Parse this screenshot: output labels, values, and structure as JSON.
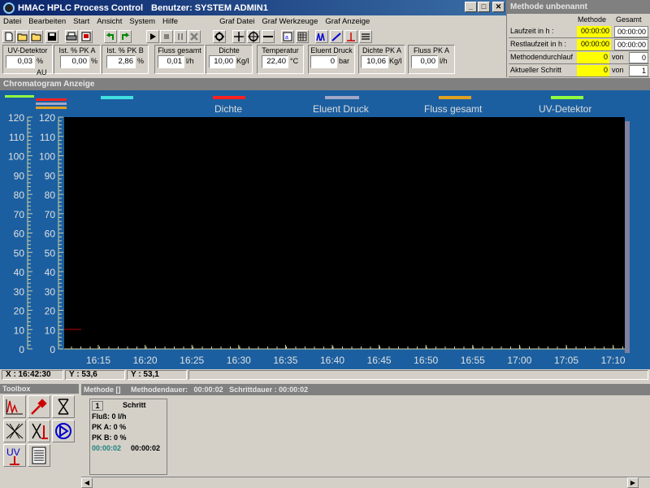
{
  "app": {
    "title": "HMAC HPLC Process Control",
    "user": "Benutzer: SYSTEM ADMIN1"
  },
  "menu": [
    "Datei",
    "Bearbeiten",
    "Start",
    "Ansicht",
    "System",
    "Hilfe",
    "Graf Datei",
    "Graf Werkzeuge",
    "Graf Anzeige"
  ],
  "fields": [
    {
      "label": "UV-Detektor",
      "value": "0,03",
      "unit": "% AU"
    },
    {
      "label": "Ist. % PK A",
      "value": "0,00",
      "unit": "%"
    },
    {
      "label": "Ist. % PK B",
      "value": "2,86",
      "unit": "%"
    },
    {
      "label": "Fluss gesamt",
      "value": "0,01",
      "unit": "l/h"
    },
    {
      "label": "Dichte",
      "value": "10,00",
      "unit": "Kg/l"
    },
    {
      "label": "Temperatur",
      "value": "22,40",
      "unit": "°C"
    },
    {
      "label": "Eluent Druck",
      "value": "0",
      "unit": "bar"
    },
    {
      "label": "Dichte PK A",
      "value": "10,06",
      "unit": "Kg/l"
    },
    {
      "label": "Fluss PK A",
      "value": "0,00",
      "unit": "l/h"
    }
  ],
  "method_panel": {
    "title": "Methode unbenannt",
    "col1": "Methode",
    "col2": "Gesamt",
    "laufzeit_label": "Laufzeit in h :",
    "laufzeit_methode": "00:00:00",
    "laufzeit_gesamt": "00:00:00",
    "restlaufzeit_label": "Restlaufzeit in h :",
    "restlaufzeit_methode": "00:00:00",
    "restlaufzeit_gesamt": "00:00:00",
    "durchlauf_label": "Methodendurchlauf",
    "durchlauf_value": "0",
    "durchlauf_von": "von",
    "durchlauf_total": "0",
    "schritt_label": "Aktueller Schritt",
    "schritt_value": "0",
    "schritt_von": "von",
    "schritt_total": "1"
  },
  "chromatogram": {
    "title": "Chromatogram Anzeige",
    "legend": [
      {
        "label": "Dichte",
        "color": "#ff2020"
      },
      {
        "label": "Eluent Druck",
        "color": "#a0a8c8"
      },
      {
        "label": "Fluss gesamt",
        "color": "#e0a020"
      },
      {
        "label": "UV-Detektor",
        "color": "#90ff40"
      }
    ],
    "y_ticks": [
      "120",
      "110",
      "100",
      "90",
      "80",
      "70",
      "60",
      "50",
      "40",
      "30",
      "20",
      "10",
      "0"
    ],
    "x_ticks": [
      "16:15",
      "16:20",
      "16:25",
      "16:30",
      "16:35",
      "16:40",
      "16:45",
      "16:50",
      "16:55",
      "17:00",
      "17:05",
      "17:10"
    ]
  },
  "status": {
    "x": "X : 16:42:30",
    "y1": "Y : 53,6",
    "y2": "Y : 53,1"
  },
  "toolbox": {
    "title": "Toolbox"
  },
  "method_bottom": {
    "title": "Methode []",
    "dauer_label": "Methodendauer:",
    "dauer_value": "00:00:02",
    "schritt_label": "Schrittdauer : 00:00:02",
    "step_num": "1",
    "step_header": "Schritt",
    "fluss": "Fluß:   0  l/h",
    "pka": "PK A:     0   %",
    "pkb": "PK B:     0   %",
    "t1": "00:00:02",
    "t2": "00:00:02"
  }
}
